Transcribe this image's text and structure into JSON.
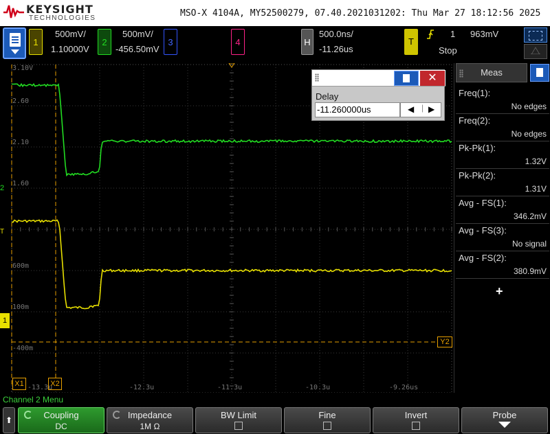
{
  "header": {
    "brand": "KEYSIGHT",
    "sub_brand": "TECHNOLOGIES",
    "title": "MSO-X 4104A, MY52500279, 07.40.2021031202: Thu Mar 27 18:12:56 2025"
  },
  "channels": [
    {
      "num": "1",
      "scale": "500mV/",
      "offset": "1.10000V",
      "color": "#e8e000"
    },
    {
      "num": "2",
      "scale": "500mV/",
      "offset": "-456.50mV",
      "color": "#22cc22"
    },
    {
      "num": "3",
      "scale": "",
      "offset": "",
      "color": "#3355ff"
    },
    {
      "num": "4",
      "scale": "",
      "offset": "",
      "color": "#ff2288"
    }
  ],
  "timebase": {
    "badge": "H",
    "scale": "500.0ns/",
    "delay": "-11.26us"
  },
  "trigger": {
    "badge": "T",
    "edge_icon": "rising-edge-icon",
    "source": "1",
    "level": "963mV",
    "mode": "Stop"
  },
  "graticule": {
    "voltage_labels": [
      "3.10V",
      "2.60",
      "2.10",
      "1.60",
      "600m",
      "100m",
      "-400m"
    ],
    "time_labels": [
      "-13.3u",
      "-12.3u",
      "-11.3u",
      "-10.3u",
      "-9.26us"
    ],
    "markers": {
      "x1": "X1",
      "x2": "X2",
      "y2": "Y2",
      "ch1": "1",
      "ch2": "2",
      "trig": "T"
    }
  },
  "delay_dialog": {
    "label": "Delay",
    "value": "-11.260000us"
  },
  "measurements": {
    "title": "Meas",
    "items": [
      {
        "label": "Freq(1):",
        "value": "No edges"
      },
      {
        "label": "Freq(2):",
        "value": "No edges"
      },
      {
        "label": "Pk-Pk(1):",
        "value": "1.32V"
      },
      {
        "label": "Pk-Pk(2):",
        "value": "1.31V"
      },
      {
        "label": "Avg - FS(1):",
        "value": "346.2mV"
      },
      {
        "label": "Avg - FS(3):",
        "value": "No signal"
      },
      {
        "label": "Avg - FS(2):",
        "value": "380.9mV"
      }
    ],
    "add_label": "+"
  },
  "menu": {
    "title": "Channel 2 Menu",
    "softkeys": [
      {
        "title": "Coupling",
        "value": "DC"
      },
      {
        "title": "Impedance",
        "value": "1M Ω"
      },
      {
        "title": "BW Limit",
        "value": ""
      },
      {
        "title": "Fine",
        "value": ""
      },
      {
        "title": "Invert",
        "value": ""
      },
      {
        "title": "Probe",
        "value": ""
      }
    ]
  },
  "waveforms": {
    "ch1": {
      "color": "#e8e000",
      "high_v": 1.1,
      "low_v": 0.05,
      "settled_v": 0.5
    },
    "ch2": {
      "color": "#22dd22",
      "high_v": 2.75,
      "low_v": 1.67,
      "settled_v": 2.07
    }
  }
}
